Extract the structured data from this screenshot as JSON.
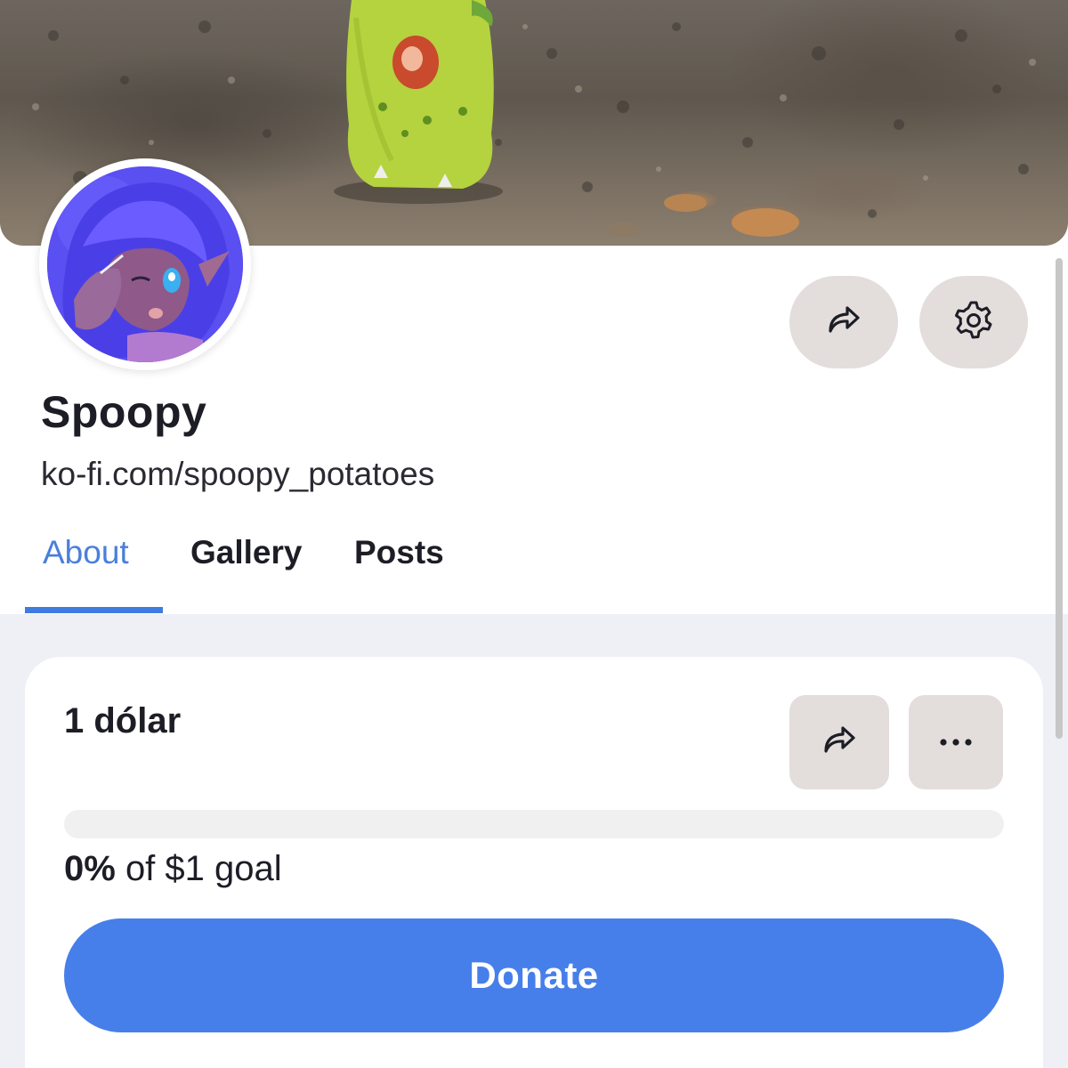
{
  "profile": {
    "name": "Spoopy",
    "url": "ko-fi.com/spoopy_potatoes"
  },
  "tabs": [
    {
      "label": "About",
      "active": true
    },
    {
      "label": "Gallery",
      "active": false
    },
    {
      "label": "Posts",
      "active": false
    }
  ],
  "header_actions": {
    "share_icon": "share-arrow-icon",
    "settings_icon": "gear-icon"
  },
  "goal": {
    "title": "1 dólar",
    "percent": "0%",
    "suffix": "of $1 goal",
    "progress_fraction": 0,
    "share_icon": "share-arrow-icon",
    "more_icon": "more-dots-icon",
    "donate_label": "Donate"
  },
  "colors": {
    "accent": "#477fea",
    "tab_active": "#4a7fdc",
    "button_bg": "#e3dddc",
    "page_bg": "#eff0f5"
  }
}
